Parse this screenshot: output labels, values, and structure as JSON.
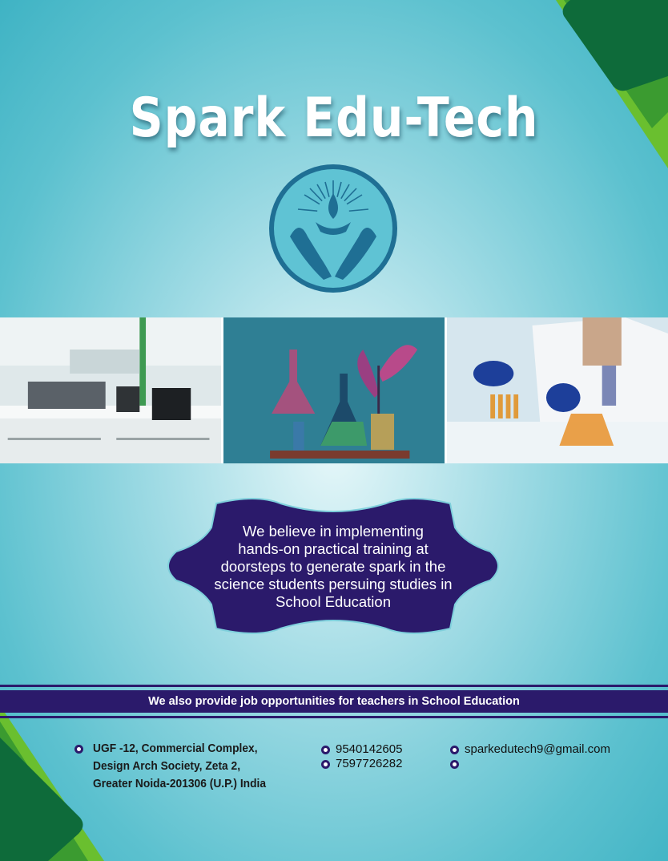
{
  "title": "Spark Edu-Tech",
  "mission": "We believe in implementing hands-on practical training at doorsteps to generate spark in the science students persuing studies in School Education",
  "mission_lines": [
    "We believe in implementing",
    "hands-on practical training at",
    "doorsteps to generate spark in the",
    "science students persuing studies in",
    "School Education"
  ],
  "banner": "We also provide job opportunities for teachers in School Education",
  "address_lines": [
    "UGF -12, Commercial Complex,",
    "Design Arch Society, Zeta 2,",
    "Greater Noida-201306 (U.P.) India"
  ],
  "phone": "9540142605",
  "whatsapp": "7597726282",
  "email": "sparkedutech9@gmail.com",
  "icons": [
    "location-icon",
    "phone-icon",
    "whatsapp-icon",
    "email-icon",
    "globe-icon"
  ],
  "colors": {
    "navy": "#2b1a6b",
    "teal": "#3fb3c4",
    "green": "#3e8f2a",
    "logo_blue": "#1f6f94"
  }
}
